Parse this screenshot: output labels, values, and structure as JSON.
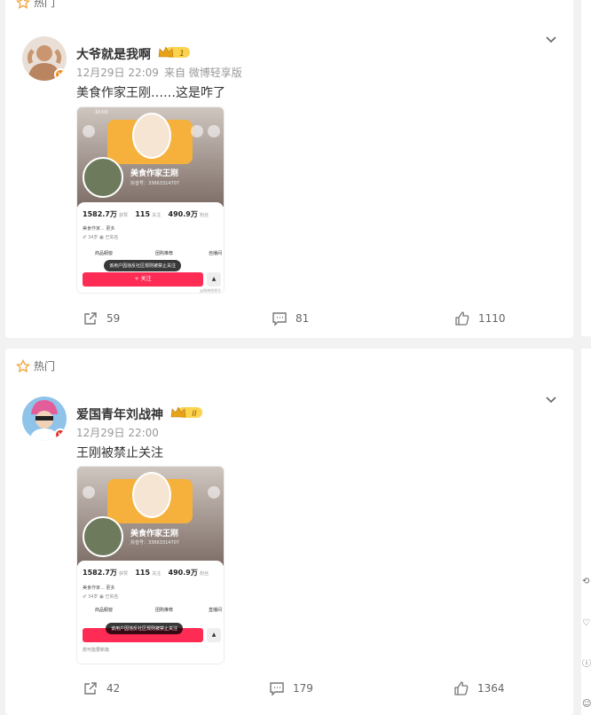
{
  "posts": [
    {
      "hot_label": "热门",
      "username": "大爷就是我啊",
      "level": "1",
      "date": "12月29日 22:09",
      "source": "来自 微博轻享版",
      "text": "美食作家王刚……这是咋了",
      "shot": {
        "time": "10:03",
        "name": "美食作家王刚",
        "id_line": "抖音号：33663314707",
        "likes_num": "1582.7万",
        "likes_label": "获赞",
        "follow_num": "115",
        "follow_label": "关注",
        "fans_num": "490.9万",
        "fans_label": "粉丝",
        "bio": "美食作家...  更多",
        "tags": "♂ 34岁   ▣ 已实名",
        "tile1": "商品橱窗",
        "tile2": "团购推荐",
        "tile3": "自播间",
        "toast": "该用户因违反社区规则被禁止关注",
        "follow_btn": "+ 关注",
        "watermark": "@微博视频号"
      },
      "reposts": "59",
      "comments": "81",
      "likes": "1110"
    },
    {
      "hot_label": "热门",
      "username": "爱国青年刘战神",
      "level": "II",
      "date": "12月29日 22:00",
      "text": "王刚被禁止关注",
      "shot": {
        "name": "美食作家王刚",
        "id_line": "抖音号：33663314707",
        "likes_num": "1582.7万",
        "likes_label": "获赞",
        "follow_num": "115",
        "follow_label": "关注",
        "fans_num": "490.9万",
        "fans_label": "粉丝",
        "bio": "美食作家...  更多",
        "tags": "♂ 34岁   ▣ 已实名",
        "tile1": "商品橱窗",
        "tile2": "团购推荐",
        "tile3": "直播间",
        "toast": "该用户因违反社区规则被禁止关注",
        "link_line": "想可能要新篇"
      },
      "reposts": "42",
      "comments": "179",
      "likes": "1364"
    }
  ],
  "colors": {
    "accent": "#f28c1e",
    "follow_red": "#fe2c55",
    "banner": "#f5b13c"
  },
  "icons": [
    "star-icon",
    "chevron-down-icon",
    "repost-icon",
    "comment-icon",
    "like-icon"
  ]
}
